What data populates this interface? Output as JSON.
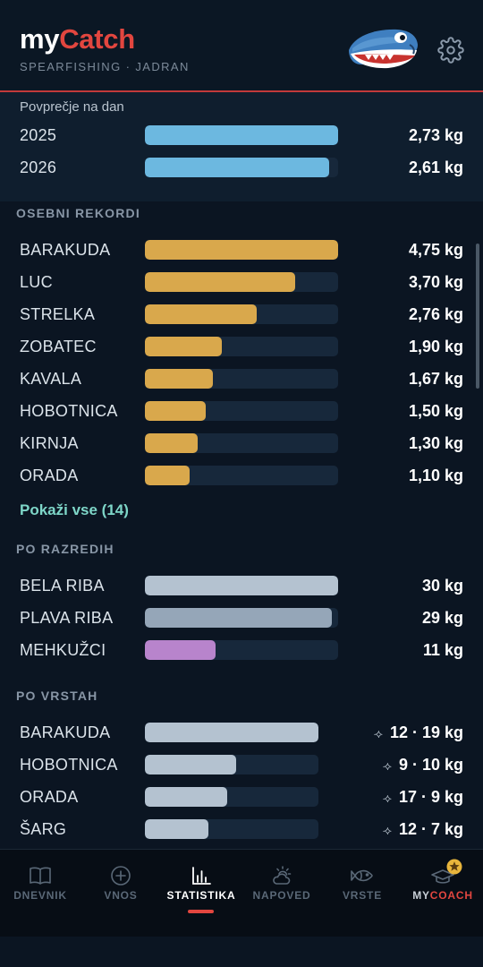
{
  "app": {
    "logo_part1": "my",
    "logo_part2": "Catch",
    "subtitle": "SPEARFISHING · JADRAN"
  },
  "average": {
    "title": "Povprečje na dan",
    "rows": [
      {
        "label": "2025",
        "value": "2,73 kg",
        "fraction": 1.0
      },
      {
        "label": "2026",
        "value": "2,61 kg",
        "fraction": 0.956
      }
    ]
  },
  "records": {
    "title": "OSEBNI REKORDI",
    "rows": [
      {
        "label": "BARAKUDA",
        "value": "4,75 kg",
        "fraction": 1.0
      },
      {
        "label": "LUC",
        "value": "3,70 kg",
        "fraction": 0.779
      },
      {
        "label": "STRELKA",
        "value": "2,76 kg",
        "fraction": 0.581
      },
      {
        "label": "ZOBATEC",
        "value": "1,90 kg",
        "fraction": 0.4
      },
      {
        "label": "KAVALA",
        "value": "1,67 kg",
        "fraction": 0.352
      },
      {
        "label": "HOBOTNICA",
        "value": "1,50 kg",
        "fraction": 0.316
      },
      {
        "label": "KIRNJA",
        "value": "1,30 kg",
        "fraction": 0.274
      },
      {
        "label": "ORADA",
        "value": "1,10 kg",
        "fraction": 0.232
      }
    ],
    "show_all": "Pokaži vse (14)"
  },
  "classes": {
    "title": "PO RAZREDIH",
    "rows": [
      {
        "label": "BELA RIBA",
        "value": "30 kg",
        "fraction": 1.0,
        "color": "#b4c2d0"
      },
      {
        "label": "PLAVA RIBA",
        "value": "29 kg",
        "fraction": 0.967,
        "color": "#95a6b8"
      },
      {
        "label": "MEHKUŽCI",
        "value": "11 kg",
        "fraction": 0.367,
        "color": "#b884cc"
      }
    ]
  },
  "species": {
    "title": "PO VRSTAH",
    "rows": [
      {
        "label": "BARAKUDA",
        "count": "12",
        "weight": "19 kg",
        "fraction": 1.0
      },
      {
        "label": "HOBOTNICA",
        "count": "9",
        "weight": "10 kg",
        "fraction": 0.526
      },
      {
        "label": "ORADA",
        "count": "17",
        "weight": "9 kg",
        "fraction": 0.474
      },
      {
        "label": "ŠARG",
        "count": "12",
        "weight": "7 kg",
        "fraction": 0.368
      }
    ]
  },
  "nav": {
    "items": [
      {
        "label": "DNEVNIK",
        "icon": "book-icon"
      },
      {
        "label": "VNOS",
        "icon": "plus-circle-icon"
      },
      {
        "label": "STATISTIKA",
        "icon": "bar-chart-icon"
      },
      {
        "label": "NAPOVED",
        "icon": "sun-cloud-icon"
      },
      {
        "label": "VRSTE",
        "icon": "fish-icon"
      },
      {
        "label": "MYCOACH",
        "icon": "graduation-cap-icon"
      }
    ],
    "active": "STATISTIKA",
    "coach_label_part1": "MY",
    "coach_label_part2": "COACH",
    "coach_badge": "star-badge-icon"
  },
  "colors": {
    "accent": "#e2463f",
    "average_bar": "#6cb8e0",
    "record_bar": "#d9a84c",
    "species_bar": "#b4c2d0",
    "track": "#17283b",
    "link": "#7ed6c8"
  }
}
